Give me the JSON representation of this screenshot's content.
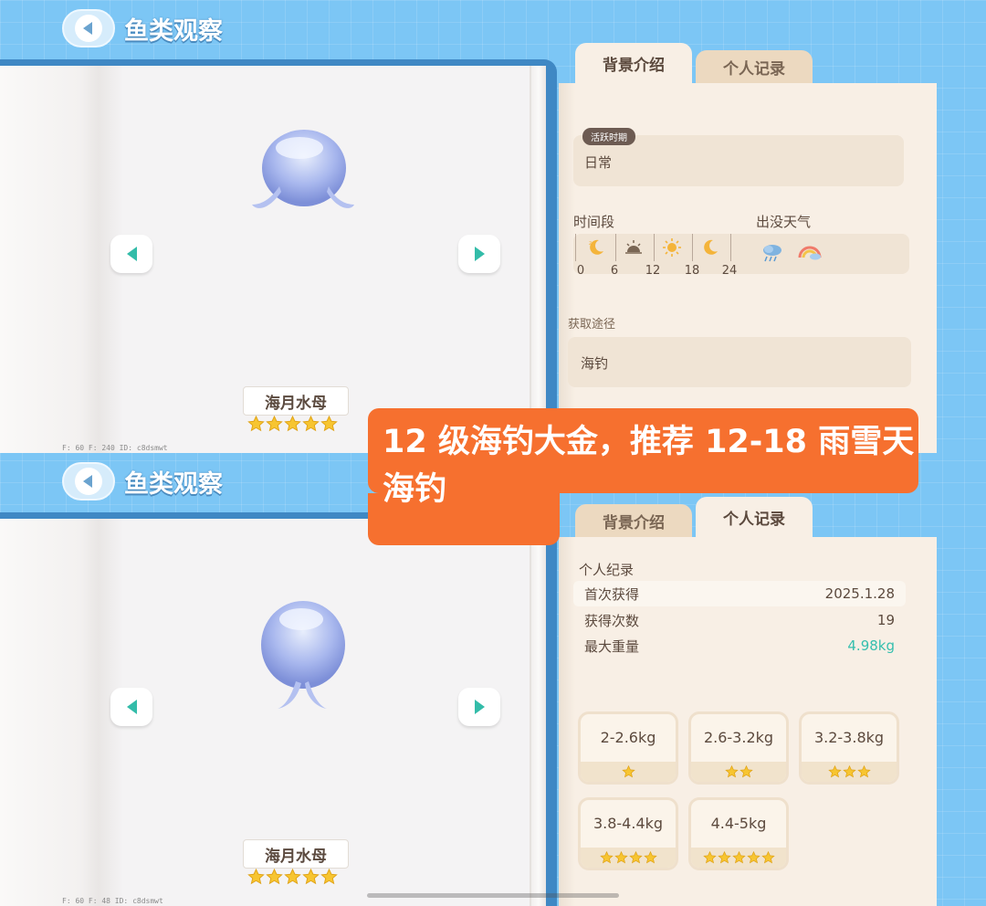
{
  "header": {
    "title": "鱼类观察"
  },
  "top_panel": {
    "fish": {
      "name": "海月水母",
      "stars": 5,
      "debug": "F: 60   F: 240   ID: c8dsmwt"
    },
    "tabs": [
      {
        "label": "背景介绍",
        "active": true
      },
      {
        "label": "个人记录",
        "active": false
      }
    ],
    "active_period": {
      "pill": "活跃时期",
      "value": "日常"
    },
    "time_section": {
      "label": "时间段",
      "icons": [
        "moon-icon",
        "sunrise-icon",
        "sun-icon",
        "moon-icon"
      ],
      "ticks": [
        "0",
        "6",
        "12",
        "18",
        "24"
      ]
    },
    "weather_section": {
      "label": "出没天气",
      "icons": [
        "rain-cloud-icon",
        "rainbow-icon"
      ]
    },
    "source_section": {
      "label": "获取途径",
      "value": "海钓"
    }
  },
  "banner": {
    "text": "12 级海钓大金，推荐 12-18 雨雪天海钓",
    "color": "#f6702f"
  },
  "bottom_panel": {
    "fish": {
      "name": "海月水母",
      "stars": 5,
      "debug": "F: 60   F: 48   ID: c8dsmwt"
    },
    "tabs": [
      {
        "label": "背景介绍",
        "active": false
      },
      {
        "label": "个人记录",
        "active": true
      }
    ],
    "record": {
      "title": "个人纪录",
      "rows": [
        {
          "label": "首次获得",
          "value": "2025.1.28"
        },
        {
          "label": "获得次数",
          "value": "19"
        },
        {
          "label": "最大重量",
          "value": "4.98kg",
          "highlight": "#35bfae"
        }
      ]
    },
    "weight_ranges": [
      {
        "label": "2-2.6kg",
        "stars": 1
      },
      {
        "label": "2.6-3.2kg",
        "stars": 2
      },
      {
        "label": "3.2-3.8kg",
        "stars": 3
      },
      {
        "label": "3.8-4.4kg",
        "stars": 4
      },
      {
        "label": "4.4-5kg",
        "stars": 5
      }
    ]
  },
  "colors": {
    "accent": "#33bca9",
    "background": "#7cc6f5",
    "paper": "#f8efe5"
  }
}
